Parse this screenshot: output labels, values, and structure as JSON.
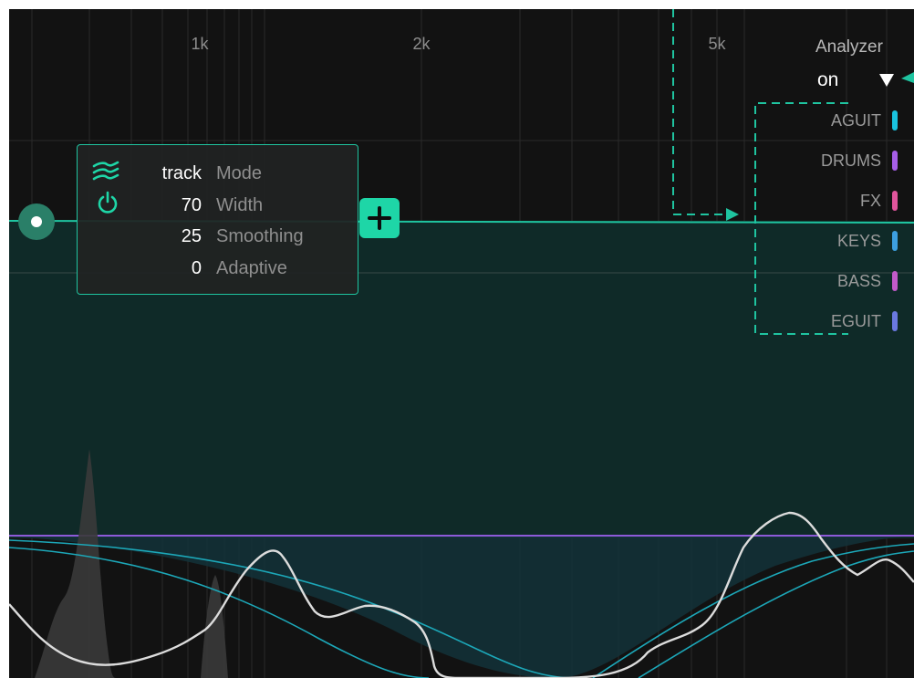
{
  "frequency_labels": [
    "1k",
    "2k",
    "5k"
  ],
  "analyzer": {
    "title": "Analyzer",
    "value": "on"
  },
  "tracks": [
    {
      "label": "AGUIT",
      "color": "#19c3e0"
    },
    {
      "label": "DRUMS",
      "color": "#a65ee8"
    },
    {
      "label": "FX",
      "color": "#e0559c"
    },
    {
      "label": "KEYS",
      "color": "#3d9fe0"
    },
    {
      "label": "BASS",
      "color": "#c25ac9"
    },
    {
      "label": "EGUIT",
      "color": "#6a78e0"
    }
  ],
  "node_panel": {
    "params": [
      {
        "value": "track",
        "name": "Mode"
      },
      {
        "value": "70",
        "name": "Width"
      },
      {
        "value": "25",
        "name": "Smoothing"
      },
      {
        "value": "0",
        "name": "Adaptive"
      }
    ]
  },
  "colors": {
    "accent": "#1ed6a7",
    "background": "#121212",
    "threshold_line": "#8d5ad8",
    "fill": "#0f2a28"
  },
  "icons": {
    "mode": "waves-icon",
    "power": "power-icon",
    "add": "plus-icon",
    "dropdown": "triangle-down-icon"
  }
}
